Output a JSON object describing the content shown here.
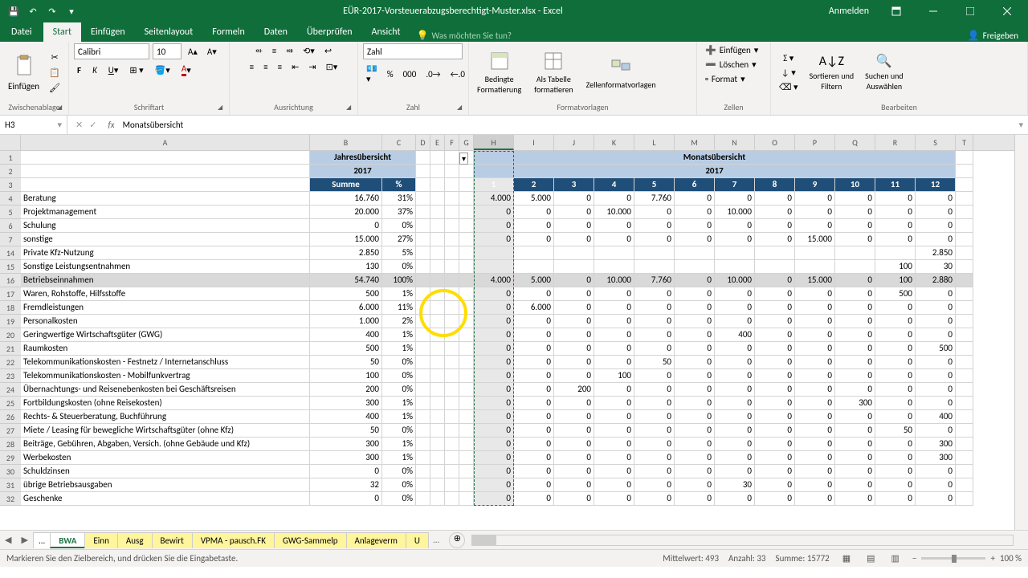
{
  "title": "EÜR-2017-Vorsteuerabzugsberechtigt-Muster.xlsx - Excel",
  "signin": "Anmelden",
  "file_tab": "Datei",
  "tabs": [
    "Start",
    "Einfügen",
    "Seitenlayout",
    "Formeln",
    "Daten",
    "Überprüfen",
    "Ansicht"
  ],
  "tellme": "Was möchten Sie tun?",
  "share": "Freigeben",
  "ribbon": {
    "clipboard": {
      "label": "Zwischenablage",
      "paste": "Einfügen"
    },
    "font": {
      "label": "Schriftart",
      "name": "Calibri",
      "size": "10"
    },
    "alignment": {
      "label": "Ausrichtung"
    },
    "number": {
      "label": "Zahl",
      "format": "Zahl"
    },
    "styles": {
      "label": "Formatvorlagen",
      "cond": "Bedingte\nFormatierung",
      "table": "Als Tabelle\nformatieren",
      "cell": "Zellenformatvorlagen"
    },
    "cells": {
      "label": "Zellen",
      "insert": "Einfügen",
      "delete": "Löschen",
      "format": "Format"
    },
    "editing": {
      "label": "Bearbeiten",
      "sort": "Sortieren und\nFiltern",
      "find": "Suchen und\nAuswählen"
    }
  },
  "namebox": "H3",
  "formula": "Monatsübersicht",
  "cols": {
    "A": 360,
    "B": 90,
    "C": 42,
    "D": 18,
    "E": 18,
    "F": 18,
    "G": 18,
    "H": 50,
    "I": 50,
    "J": 50,
    "K": 50,
    "L": 50,
    "M": 50,
    "N": 50,
    "O": 50,
    "P": 50,
    "Q": 50,
    "R": 50,
    "S": 50,
    "T": 22
  },
  "jahres": "Jahresübersicht",
  "monats": "Monatsübersicht",
  "year": "2017",
  "summe": "Summe",
  "pct": "%",
  "months": [
    "1",
    "2",
    "3",
    "4",
    "5",
    "6",
    "7",
    "8",
    "9",
    "10",
    "11",
    "12"
  ],
  "rows": [
    {
      "n": 4,
      "a": "Beratung",
      "b": "16.760",
      "c": "31%",
      "m": [
        "4.000",
        "5.000",
        "0",
        "0",
        "7.760",
        "0",
        "0",
        "0",
        "0",
        "0",
        "0",
        "0"
      ]
    },
    {
      "n": 5,
      "a": "Projektmanagement",
      "b": "20.000",
      "c": "37%",
      "m": [
        "0",
        "0",
        "0",
        "10.000",
        "0",
        "0",
        "10.000",
        "0",
        "0",
        "0",
        "0",
        "0"
      ]
    },
    {
      "n": 6,
      "a": "Schulung",
      "b": "0",
      "c": "0%",
      "m": [
        "0",
        "0",
        "0",
        "0",
        "0",
        "0",
        "0",
        "0",
        "0",
        "0",
        "0",
        "0"
      ]
    },
    {
      "n": 7,
      "a": "sonstige",
      "b": "15.000",
      "c": "27%",
      "m": [
        "0",
        "0",
        "0",
        "0",
        "0",
        "0",
        "0",
        "0",
        "15.000",
        "0",
        "0",
        "0"
      ]
    },
    {
      "n": 14,
      "a": "Private Kfz-Nutzung",
      "b": "2.850",
      "c": "5%",
      "m": [
        "",
        "",
        "",
        "",
        "",
        "",
        "",
        "",
        "",
        "",
        "",
        "2.850"
      ]
    },
    {
      "n": 15,
      "a": "Sonstige Leistungsentnahmen",
      "b": "130",
      "c": "0%",
      "m": [
        "",
        "",
        "",
        "",
        "",
        "",
        "",
        "",
        "",
        "",
        "100",
        "30"
      ]
    },
    {
      "n": 16,
      "a": "Betriebseinnahmen",
      "b": "54.740",
      "c": "100%",
      "sum": true,
      "m": [
        "4.000",
        "5.000",
        "0",
        "10.000",
        "7.760",
        "0",
        "10.000",
        "0",
        "15.000",
        "0",
        "100",
        "2.880"
      ]
    },
    {
      "n": 17,
      "a": "Waren, Rohstoffe, Hilfsstoffe",
      "b": "500",
      "c": "1%",
      "m": [
        "0",
        "0",
        "0",
        "0",
        "0",
        "0",
        "0",
        "0",
        "0",
        "0",
        "500",
        "0"
      ]
    },
    {
      "n": 18,
      "a": "Fremdleistungen",
      "b": "6.000",
      "c": "11%",
      "m": [
        "0",
        "6.000",
        "0",
        "0",
        "0",
        "0",
        "0",
        "0",
        "0",
        "0",
        "0",
        "0"
      ]
    },
    {
      "n": 19,
      "a": "Personalkosten",
      "b": "1.000",
      "c": "2%",
      "m": [
        "0",
        "0",
        "0",
        "0",
        "0",
        "0",
        "0",
        "0",
        "0",
        "0",
        "0",
        "0"
      ]
    },
    {
      "n": 20,
      "a": "Geringwertige Wirtschaftsgüter (GWG)",
      "b": "400",
      "c": "1%",
      "m": [
        "0",
        "0",
        "0",
        "0",
        "0",
        "0",
        "400",
        "0",
        "0",
        "0",
        "0",
        "0"
      ]
    },
    {
      "n": 21,
      "a": "Raumkosten",
      "b": "500",
      "c": "1%",
      "m": [
        "0",
        "0",
        "0",
        "0",
        "0",
        "0",
        "0",
        "0",
        "0",
        "0",
        "0",
        "500"
      ]
    },
    {
      "n": 22,
      "a": "Telekommunikationskosten - Festnetz / Internetanschluss",
      "b": "50",
      "c": "0%",
      "m": [
        "0",
        "0",
        "0",
        "0",
        "50",
        "0",
        "0",
        "0",
        "0",
        "0",
        "0",
        "0"
      ]
    },
    {
      "n": 23,
      "a": "Telekommunikationskosten - Mobilfunkvertrag",
      "b": "100",
      "c": "0%",
      "m": [
        "0",
        "0",
        "0",
        "100",
        "0",
        "0",
        "0",
        "0",
        "0",
        "0",
        "0",
        "0"
      ]
    },
    {
      "n": 24,
      "a": "Übernachtungs- und Reisenebenkosten bei Geschäftsreisen",
      "b": "200",
      "c": "0%",
      "m": [
        "0",
        "0",
        "200",
        "0",
        "0",
        "0",
        "0",
        "0",
        "0",
        "0",
        "0",
        "0"
      ]
    },
    {
      "n": 25,
      "a": "Fortbildungskosten (ohne Reisekosten)",
      "b": "300",
      "c": "1%",
      "m": [
        "0",
        "0",
        "0",
        "0",
        "0",
        "0",
        "0",
        "0",
        "0",
        "300",
        "0",
        "0"
      ]
    },
    {
      "n": 26,
      "a": "Rechts- & Steuerberatung, Buchführung",
      "b": "400",
      "c": "1%",
      "m": [
        "0",
        "0",
        "0",
        "0",
        "0",
        "0",
        "0",
        "0",
        "0",
        "0",
        "0",
        "400"
      ]
    },
    {
      "n": 27,
      "a": "Miete / Leasing für bewegliche Wirtschaftsgüter (ohne Kfz)",
      "b": "50",
      "c": "0%",
      "m": [
        "0",
        "0",
        "0",
        "0",
        "0",
        "0",
        "0",
        "0",
        "0",
        "0",
        "50",
        "0"
      ]
    },
    {
      "n": 28,
      "a": "Beiträge, Gebühren, Abgaben, Versich. (ohne Gebäude und Kfz)",
      "b": "300",
      "c": "1%",
      "m": [
        "0",
        "0",
        "0",
        "0",
        "0",
        "0",
        "0",
        "0",
        "0",
        "0",
        "0",
        "300"
      ]
    },
    {
      "n": 29,
      "a": "Werbekosten",
      "b": "300",
      "c": "1%",
      "m": [
        "0",
        "0",
        "0",
        "0",
        "0",
        "0",
        "0",
        "0",
        "0",
        "0",
        "0",
        "300"
      ]
    },
    {
      "n": 30,
      "a": "Schuldzinsen",
      "b": "0",
      "c": "0%",
      "m": [
        "0",
        "0",
        "0",
        "0",
        "0",
        "0",
        "0",
        "0",
        "0",
        "0",
        "0",
        "0"
      ]
    },
    {
      "n": 31,
      "a": "übrige Betriebsausgaben",
      "b": "32",
      "c": "0%",
      "m": [
        "0",
        "0",
        "0",
        "0",
        "0",
        "0",
        "30",
        "0",
        "0",
        "0",
        "0",
        "0"
      ]
    },
    {
      "n": 32,
      "a": "Geschenke",
      "b": "0",
      "c": "0%",
      "m": [
        "0",
        "0",
        "0",
        "0",
        "0",
        "0",
        "0",
        "0",
        "0",
        "0",
        "0",
        "0"
      ]
    }
  ],
  "sheets": [
    "...",
    "BWA",
    "Einn",
    "Ausg",
    "Bewirt",
    "VPMA - pausch.FK",
    "GWG-Sammelp",
    "Anlageverm",
    "U"
  ],
  "active_sheet": "BWA",
  "status": {
    "msg": "Markieren Sie den Zielbereich, und drücken Sie die Eingabetaste.",
    "avg_label": "Mittelwert:",
    "avg": "493",
    "count_label": "Anzahl:",
    "count": "33",
    "sum_label": "Summe:",
    "sum": "15772",
    "zoom": "100 %"
  }
}
